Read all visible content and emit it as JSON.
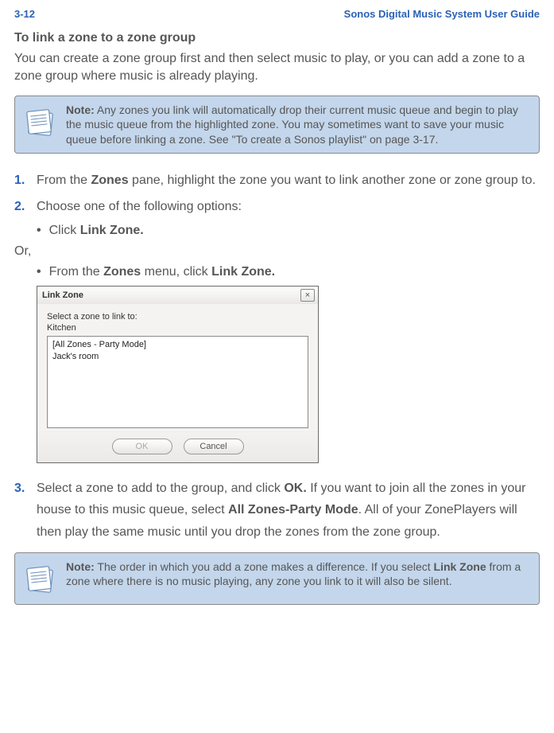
{
  "header": {
    "page_number": "3-12",
    "guide_title": "Sonos Digital Music System User Guide"
  },
  "section_heading": "To link a zone to a zone group",
  "intro": "You can create a zone group first and then select music to play, or you can add a zone to a zone group where music is already playing.",
  "note1": {
    "label": "Note:",
    "text": "Any zones you link will automatically drop their current music queue and begin to play the music queue from the highlighted zone. You may sometimes want to save your music queue before linking a zone. See \"To create a Sonos playlist\" on page 3-17."
  },
  "steps": {
    "s1_num": "1.",
    "s1_a": "From the ",
    "s1_b": "Zones",
    "s1_c": " pane, highlight the zone you want to link another zone or zone group to.",
    "s2_num": "2.",
    "s2_a": "Choose one of the following options:",
    "b1_a": "Click ",
    "b1_b": "Link Zone.",
    "or": "Or,",
    "b2_a": "From the ",
    "b2_b": "Zones",
    "b2_c": " menu, click ",
    "b2_d": "Link Zone.",
    "s3_num": "3.",
    "s3_a": "Select a zone to add to the group, and click ",
    "s3_b": "OK.",
    "s3_c": " If you want to join all the zones in your house to this music queue, select ",
    "s3_d": "All Zones-Party Mode",
    "s3_e": ". All of your ZonePlayers will then play the same music until you drop the zones from the zone group."
  },
  "dialog": {
    "title": "Link Zone",
    "label": "Select a zone to link to:",
    "current": "Kitchen",
    "items": [
      "[All Zones - Party Mode]",
      "Jack's room"
    ],
    "ok": "OK",
    "cancel": "Cancel",
    "close": "×"
  },
  "note2": {
    "label": "Note:",
    "a": "The order in which you add a zone makes a difference. If you select ",
    "b": "Link Zone",
    "c": " from a zone where there is no music playing, any zone you link to it will also be silent."
  }
}
